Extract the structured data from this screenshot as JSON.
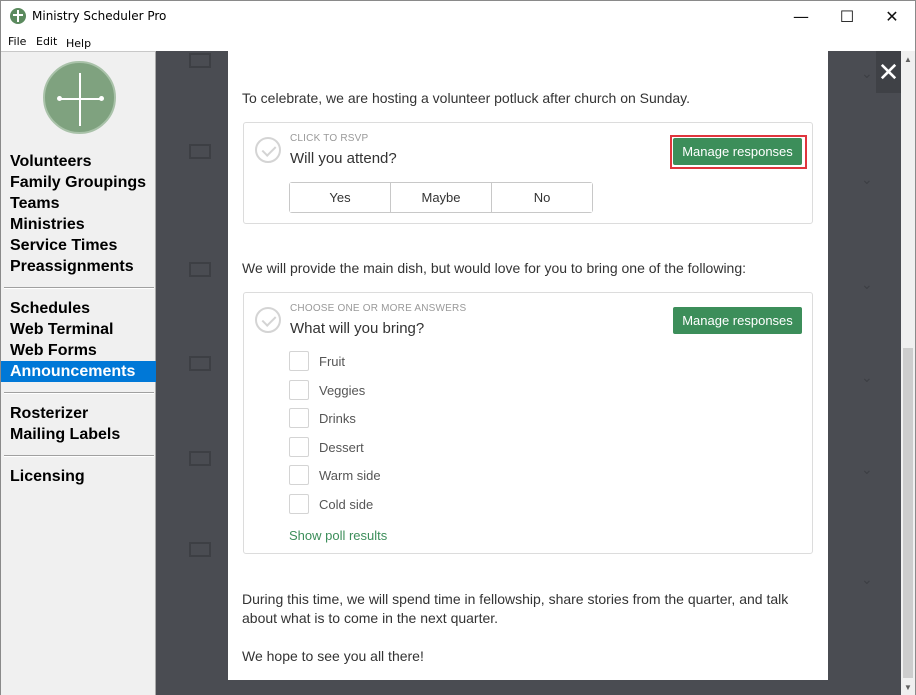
{
  "window": {
    "title": "Ministry Scheduler Pro",
    "minimize": "—",
    "maximize": "☐",
    "close": "✕"
  },
  "menu": [
    "File",
    "Edit",
    "Help"
  ],
  "sidebar": {
    "group1": [
      "Volunteers",
      "Family Groupings",
      "Teams",
      "Ministries",
      "Service Times",
      "Preassignments"
    ],
    "group2": [
      "Schedules",
      "Web Terminal",
      "Web Forms",
      "Announcements"
    ],
    "group3": [
      "Rosterizer",
      "Mailing Labels"
    ],
    "group4": [
      "Licensing"
    ],
    "active": "Announcements"
  },
  "overlay_close": "✕",
  "content": {
    "intro": "To celebrate, we are hosting a volunteer potluck after church on Sunday.",
    "poll1": {
      "kicker": "CLICK TO RSVP",
      "question": "Will you attend?",
      "manage": "Manage responses",
      "options": [
        "Yes",
        "Maybe",
        "No"
      ]
    },
    "middle": "We will provide the main dish, but would love for you to bring one of the following:",
    "poll2": {
      "kicker": "CHOOSE ONE OR MORE ANSWERS",
      "question": "What will you bring?",
      "manage": "Manage responses",
      "options": [
        "Fruit",
        "Veggies",
        "Drinks",
        "Dessert",
        "Warm side",
        "Cold side"
      ],
      "results_link": "Show poll results"
    },
    "closing1": "During this time, we will spend time in fellowship, share stories from the quarter, and talk about what is to come in the next quarter.",
    "closing2": "We hope to see you all there!"
  },
  "colors": {
    "accent_green": "#3c8e5a",
    "highlight_red": "#e0353d",
    "active_nav": "#0078d7"
  }
}
